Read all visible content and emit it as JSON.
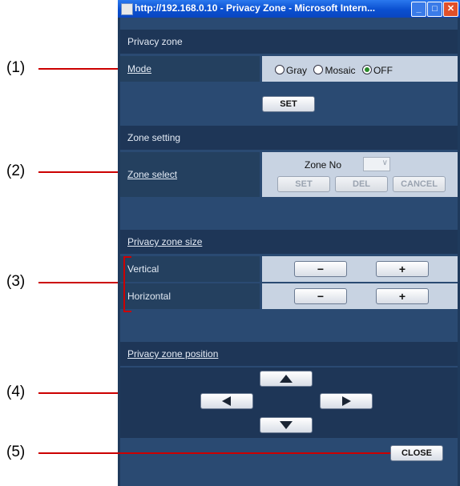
{
  "callouts": [
    "(1)",
    "(2)",
    "(3)",
    "(4)",
    "(5)"
  ],
  "window": {
    "title": "http://192.168.0.10 - Privacy Zone - Microsoft Intern...",
    "minimize_icon": "minimize-icon",
    "maximize_icon": "maximize-icon",
    "close_icon": "close-icon"
  },
  "privacy_zone": {
    "heading": "Privacy zone",
    "mode_label": "Mode",
    "mode_options": [
      "Gray",
      "Mosaic",
      "OFF"
    ],
    "mode_selected": "OFF",
    "set_button": "SET"
  },
  "zone_setting": {
    "heading": "Zone setting",
    "zone_select_label": "Zone select",
    "zone_no_label": "Zone No",
    "zone_no_value": "",
    "set_button": "SET",
    "del_button": "DEL",
    "cancel_button": "CANCEL"
  },
  "size": {
    "heading": "Privacy zone size",
    "vertical_label": "Vertical",
    "horizontal_label": "Horizontal",
    "minus": "−",
    "plus": "+"
  },
  "position": {
    "heading": "Privacy zone position",
    "up_icon": "arrow-up-icon",
    "left_icon": "arrow-left-icon",
    "right_icon": "arrow-right-icon",
    "down_icon": "arrow-down-icon"
  },
  "close_button": "CLOSE",
  "colors": {
    "callout_line": "#cc0000",
    "titlebar": "#0a57d6",
    "panel": "#2a4a72"
  }
}
